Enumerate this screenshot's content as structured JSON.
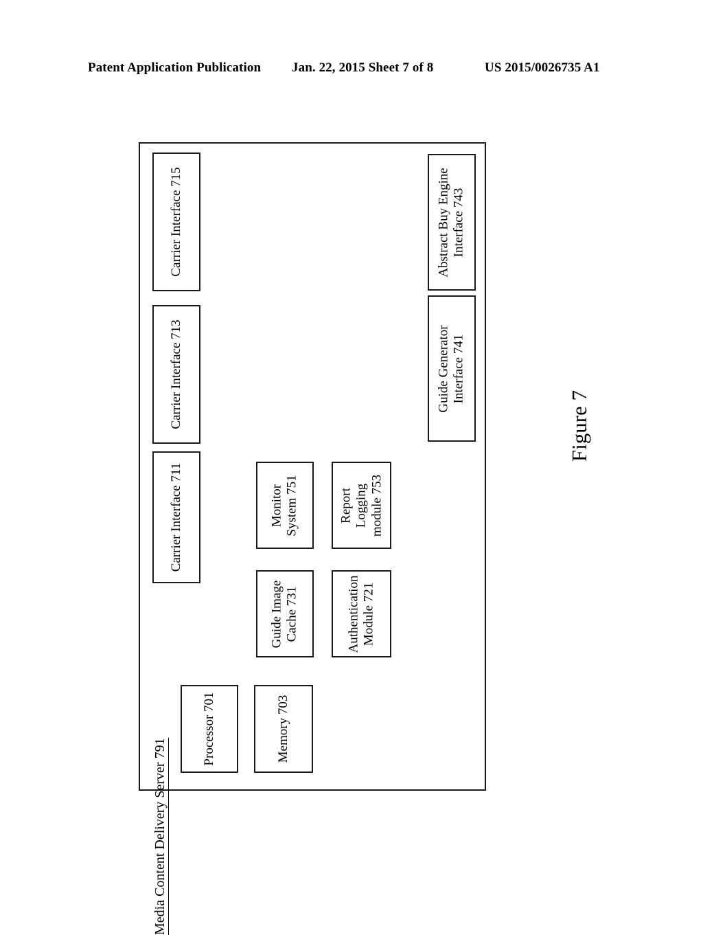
{
  "header": {
    "left": "Patent Application Publication",
    "middle": "Jan. 22, 2015  Sheet 7 of 8",
    "right": "US 2015/0026735 A1"
  },
  "figure": {
    "caption": "Figure 7"
  },
  "diagram": {
    "container_title": "Media Content Delivery Server 791",
    "boxes": [
      {
        "id": "carrier_715",
        "label": "Carrier Interface 715"
      },
      {
        "id": "carrier_713",
        "label": "Carrier Interface 713"
      },
      {
        "id": "carrier_711",
        "label": "Carrier Interface 711"
      },
      {
        "id": "abstract_buy_743",
        "label": "Abstract Buy Engine\nInterface 743"
      },
      {
        "id": "guide_generator_741",
        "label": "Guide Generator\nInterface 741"
      },
      {
        "id": "monitor_751",
        "label": "Monitor\nSystem 751"
      },
      {
        "id": "report_753",
        "label": "Report\nLogging\nmodule 753"
      },
      {
        "id": "guide_cache_731",
        "label": "Guide Image\nCache 731"
      },
      {
        "id": "auth_721",
        "label": "Authentication\nModule 721"
      },
      {
        "id": "processor_701",
        "label": "Processor 701"
      },
      {
        "id": "memory_703",
        "label": "Memory 703"
      }
    ]
  }
}
